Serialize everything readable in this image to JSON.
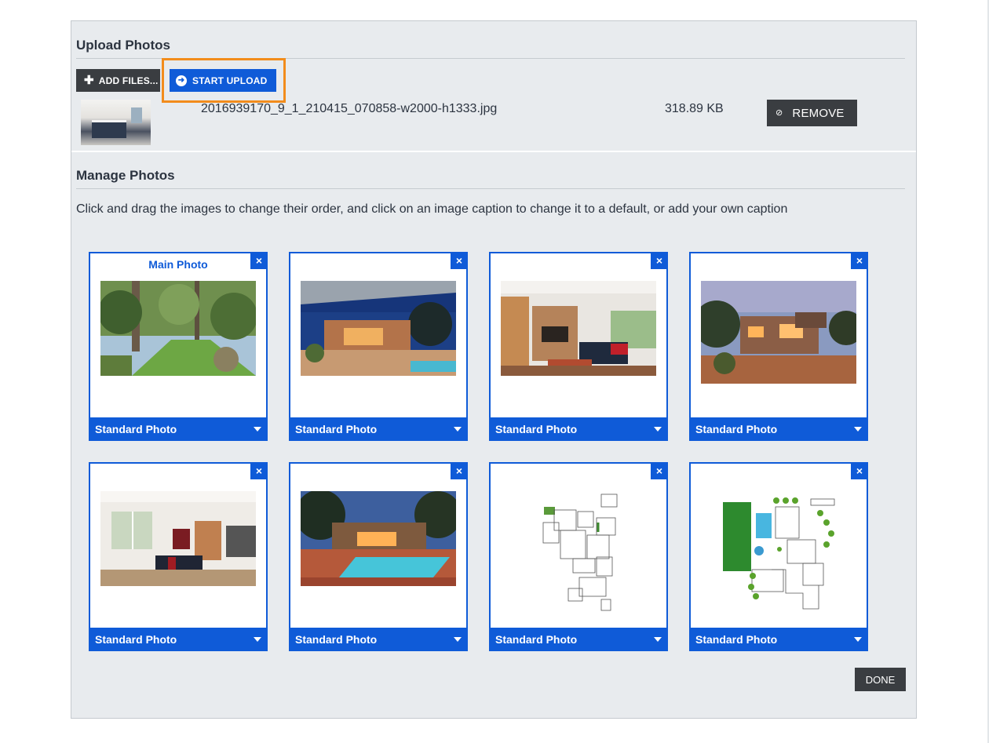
{
  "upload": {
    "title": "Upload Photos",
    "add_files_label": "ADD FILES...",
    "start_upload_label": "START UPLOAD",
    "file": {
      "name": "2016939170_9_1_210415_070858-w2000-h1333.jpg",
      "size": "318.89 KB",
      "remove_label": "REMOVE"
    }
  },
  "manage": {
    "title": "Manage Photos",
    "instructions": "Click and drag the images to change their order, and click on an image caption to change it to a default, or add your own caption",
    "main_label": "Main Photo",
    "close_glyph": "×",
    "photos": [
      {
        "caption": "Standard Photo",
        "subject": "garden-lawn"
      },
      {
        "caption": "Standard Photo",
        "subject": "house-exterior-dusk"
      },
      {
        "caption": "Standard Photo",
        "subject": "living-room-fireplace"
      },
      {
        "caption": "Standard Photo",
        "subject": "house-exterior-evening"
      },
      {
        "caption": "Standard Photo",
        "subject": "living-room-windows"
      },
      {
        "caption": "Standard Photo",
        "subject": "pool-dusk"
      },
      {
        "caption": "Standard Photo",
        "subject": "floor-plan"
      },
      {
        "caption": "Standard Photo",
        "subject": "site-plan"
      }
    ]
  },
  "done_label": "DONE",
  "colors": {
    "accent": "#0f5bd8",
    "dark_button": "#3a3d41",
    "highlight": "#f28c1c",
    "panel_bg": "#e8ebee"
  }
}
